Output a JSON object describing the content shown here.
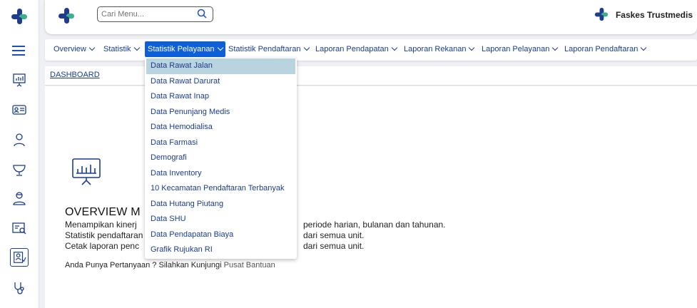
{
  "search": {
    "placeholder": "Cari Menu..."
  },
  "header": {
    "brand": "Faskes Trustmedis"
  },
  "nav": {
    "items": [
      {
        "label": "Overview",
        "active": false
      },
      {
        "label": "Statistik",
        "active": false
      },
      {
        "label": "Statistik Pelayanan",
        "active": true
      },
      {
        "label": "Statistik Pendaftaran",
        "active": false
      },
      {
        "label": "Laporan Pendapatan",
        "active": false
      },
      {
        "label": "Laporan Rekanan",
        "active": false
      },
      {
        "label": "Laporan Pelayanan",
        "active": false
      },
      {
        "label": "Laporan Pendaftaran",
        "active": false
      }
    ]
  },
  "breadcrumb": {
    "label": "DASHBOARD"
  },
  "dropdown": {
    "items": [
      "Data Rawat Jalan",
      "Data Rawat Darurat",
      "Data Rawat Inap",
      "Data Penunjang Medis",
      "Data Hemodialisa",
      "Data Farmasi",
      "Demografi",
      "Data Inventory",
      "10 Kecamatan Pendaftaran Terbanyak",
      "Data Hutang Piutang",
      "Data SHU",
      "Data Pendapatan Biaya",
      "Grafik Rujukan RI"
    ],
    "highlighted_index": 0
  },
  "overview": {
    "title": "OVERVIEW M",
    "lines": [
      "Menampikan kinerj",
      "Statistik pendaftaran",
      "Cetak laporan penc"
    ],
    "line_tails": [
      "periode harian, bulanan dan tahunan.",
      "dari semua unit.",
      "dari semua unit."
    ],
    "help_text": "Anda Punya Pertanyaan ? Silahkan Kunjungi",
    "help_link": "Pusat Bantuan"
  },
  "colors": {
    "accent": "#0f60d8",
    "nav_text": "#1a3c8f",
    "highlight": "#b9d3df",
    "logo_blue": "#1f3d8c",
    "logo_green": "#3bb08f"
  }
}
